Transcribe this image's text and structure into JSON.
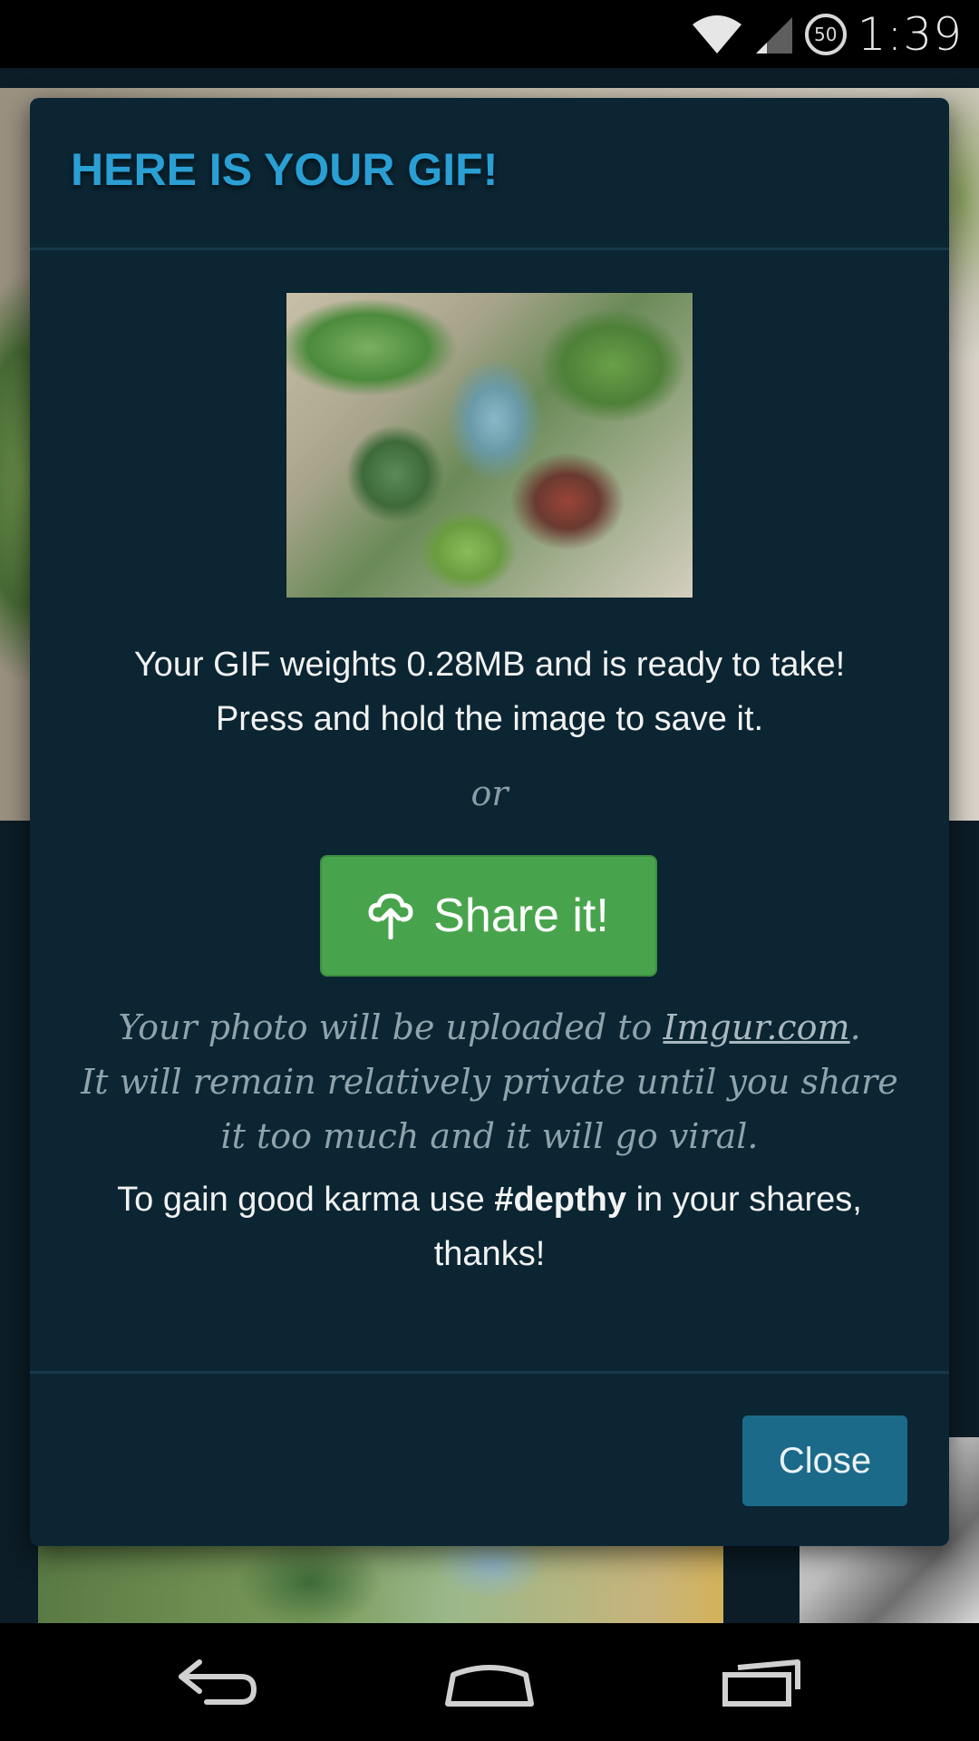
{
  "status_bar": {
    "time": "1:39",
    "battery_level": "50",
    "icons": [
      "wifi-icon",
      "cell-signal-icon",
      "battery-icon"
    ]
  },
  "dialog": {
    "title": "HERE IS YOUR GIF!",
    "description_line1": "Your GIF weights 0.28MB and is ready to take!",
    "description_line2": "Press and hold the image to save it.",
    "or_text": "or",
    "share_button_label": "Share it!",
    "share_icon": "cloud-upload-icon",
    "upload_note_prefix": "Your photo will be uploaded to ",
    "upload_note_link": "Imgur.com",
    "upload_note_suffix": ".",
    "upload_note_line2": "It will remain relatively private until you share",
    "upload_note_line3": "it too much and it will go viral.",
    "karma_prefix": "To gain good karma use ",
    "karma_hashtag": "#depthy",
    "karma_suffix": " in your shares,",
    "karma_line2": "thanks!",
    "close_button_label": "Close"
  },
  "nav_bar": {
    "buttons": [
      "back-icon",
      "home-icon",
      "recents-icon"
    ]
  },
  "colors": {
    "title": "#2a9fd4",
    "dialog_bg": "#0b2532",
    "share_button": "#48a44c",
    "close_button": "#1c6a8a"
  }
}
